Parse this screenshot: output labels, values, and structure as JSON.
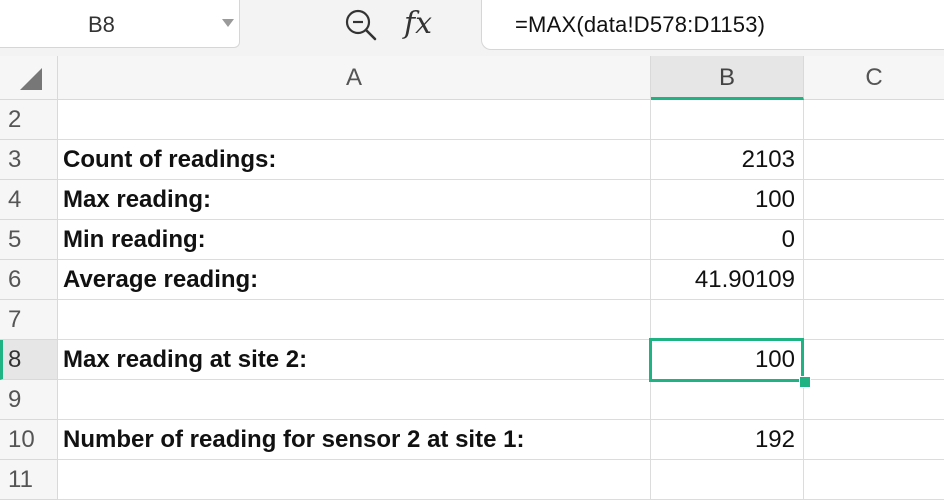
{
  "formula_bar": {
    "name_box": "B8",
    "formula": "=MAX(data!D578:D1153)",
    "icons": [
      "zoom-icon",
      "fx-icon"
    ],
    "fx_label": "fx"
  },
  "sheet": {
    "columns": [
      "A",
      "B",
      "C"
    ],
    "selected_column": "B",
    "selected_row": "8",
    "rows": [
      {
        "num": "2",
        "a": "",
        "b": ""
      },
      {
        "num": "3",
        "a": "Count of readings:",
        "b": "2103"
      },
      {
        "num": "4",
        "a": "Max reading:",
        "b": "100"
      },
      {
        "num": "5",
        "a": "Min reading:",
        "b": "0"
      },
      {
        "num": "6",
        "a": "Average reading:",
        "b": "41.90109"
      },
      {
        "num": "7",
        "a": "",
        "b": ""
      },
      {
        "num": "8",
        "a": "Max reading at site 2:",
        "b": "100"
      },
      {
        "num": "9",
        "a": "",
        "b": ""
      },
      {
        "num": "10",
        "a": "Number of reading for sensor 2 at site 1:",
        "b": "192"
      },
      {
        "num": "11",
        "a": "",
        "b": ""
      }
    ]
  },
  "colors": {
    "accent": "#1fb383",
    "header_bg": "#f6f6f6",
    "grid_line": "#dcdcdc"
  }
}
